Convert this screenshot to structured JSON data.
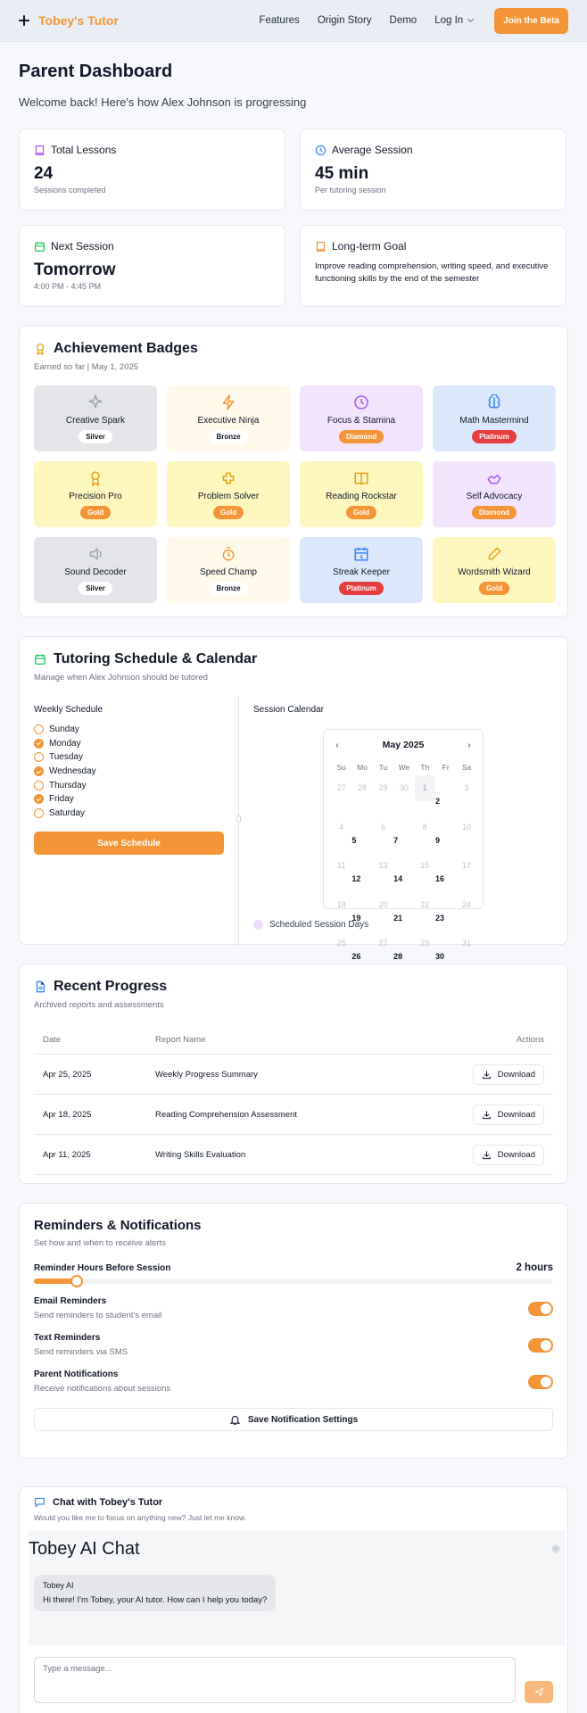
{
  "header": {
    "brand": "Tobey's Tutor",
    "nav": [
      "Features",
      "Origin Story",
      "Demo"
    ],
    "login": "Log In",
    "cta": "Join the Beta"
  },
  "page": {
    "title": "Parent Dashboard",
    "welcome": "Welcome back! Here's how Alex Johnson is progressing"
  },
  "stats": {
    "lessons": {
      "label": "Total Lessons",
      "value": "24",
      "sub": "Sessions completed"
    },
    "average": {
      "label": "Average Session",
      "value": "45 min",
      "sub": "Per tutoring session"
    },
    "next": {
      "label": "Next Session",
      "value": "Tomorrow",
      "sub": "4:00 PM - 4:45 PM"
    },
    "goal": {
      "label": "Long-term Goal",
      "text": "Improve reading comprehension, writing speed, and executive functioning skills by the end of the semester"
    }
  },
  "badges": {
    "title": "Achievement Badges",
    "subtitle": "Earned so far | May 1, 2025",
    "items": [
      {
        "name": "Creative Spark",
        "tier": "Silver"
      },
      {
        "name": "Executive Ninja",
        "tier": "Bronze"
      },
      {
        "name": "Focus & Stamina",
        "tier": "Diamond"
      },
      {
        "name": "Math Mastermind",
        "tier": "Platinum"
      },
      {
        "name": "Precision Pro",
        "tier": "Gold"
      },
      {
        "name": "Problem Solver",
        "tier": "Gold"
      },
      {
        "name": "Reading Rockstar",
        "tier": "Gold"
      },
      {
        "name": "Self Advocacy",
        "tier": "Diamond"
      },
      {
        "name": "Sound Decoder",
        "tier": "Silver"
      },
      {
        "name": "Speed Champ",
        "tier": "Bronze"
      },
      {
        "name": "Streak Keeper",
        "tier": "Platinum"
      },
      {
        "name": "Wordsmith Wizard",
        "tier": "Gold"
      }
    ],
    "tier_colors": {
      "Silver": {
        "bg": "#e4e5e8",
        "pill_bg": "#ffffff",
        "pill_fg": "#111827",
        "icon": "#9ca3af"
      },
      "Bronze": {
        "bg": "#fef9e8",
        "pill_bg": "#ffffff",
        "pill_fg": "#111827",
        "icon": "#f39536"
      },
      "Diamond": {
        "bg": "#f1e4fc",
        "pill_bg": "#f39536",
        "pill_fg": "#ffffff",
        "icon": "#a855f7"
      },
      "Platinum": {
        "bg": "#dbe8fb",
        "pill_bg": "#e53e3e",
        "pill_fg": "#ffffff",
        "icon": "#3b82f6"
      },
      "Gold": {
        "bg": "#fdf6bd",
        "pill_bg": "#f39536",
        "pill_fg": "#ffffff",
        "icon": "#e8a317"
      }
    }
  },
  "schedule": {
    "title": "Tutoring Schedule & Calendar",
    "subtitle": "Manage when Alex Johnson should be tutored",
    "weekly_label": "Weekly Schedule",
    "days": [
      {
        "name": "Sunday",
        "on": false
      },
      {
        "name": "Monday",
        "on": true
      },
      {
        "name": "Tuesday",
        "on": false
      },
      {
        "name": "Wednesday",
        "on": true
      },
      {
        "name": "Thursday",
        "on": false
      },
      {
        "name": "Friday",
        "on": true
      },
      {
        "name": "Saturday",
        "on": false
      }
    ],
    "save": "Save Schedule",
    "calendar_label": "Session Calendar",
    "month": "May 2025",
    "weekdays": [
      "Su",
      "Mo",
      "Tu",
      "We",
      "Th",
      "Fr",
      "Sa"
    ],
    "cells": [
      {
        "d": "27",
        "k": "muted"
      },
      {
        "d": "28",
        "k": "muted"
      },
      {
        "d": "29",
        "k": "muted"
      },
      {
        "d": "30",
        "k": "muted"
      },
      {
        "d": "1",
        "k": "today"
      },
      {
        "d": "2",
        "k": "sched"
      },
      {
        "d": "3",
        "k": "muted"
      },
      {
        "d": "4",
        "k": "muted"
      },
      {
        "d": "5",
        "k": "sched"
      },
      {
        "d": "6",
        "k": "muted"
      },
      {
        "d": "7",
        "k": "sched"
      },
      {
        "d": "8",
        "k": "muted"
      },
      {
        "d": "9",
        "k": "sched"
      },
      {
        "d": "10",
        "k": "muted"
      },
      {
        "d": "11",
        "k": "muted"
      },
      {
        "d": "12",
        "k": "sched"
      },
      {
        "d": "13",
        "k": "muted"
      },
      {
        "d": "14",
        "k": "sched"
      },
      {
        "d": "15",
        "k": "muted"
      },
      {
        "d": "16",
        "k": "sched"
      },
      {
        "d": "17",
        "k": "muted"
      },
      {
        "d": "18",
        "k": "muted"
      },
      {
        "d": "19",
        "k": "sched"
      },
      {
        "d": "20",
        "k": "muted"
      },
      {
        "d": "21",
        "k": "sched"
      },
      {
        "d": "22",
        "k": "muted"
      },
      {
        "d": "23",
        "k": "sched"
      },
      {
        "d": "24",
        "k": "muted"
      },
      {
        "d": "25",
        "k": "muted"
      },
      {
        "d": "26",
        "k": "sched"
      },
      {
        "d": "27",
        "k": "muted"
      },
      {
        "d": "28",
        "k": "sched"
      },
      {
        "d": "29",
        "k": "muted"
      },
      {
        "d": "30",
        "k": "sched"
      },
      {
        "d": "31",
        "k": "muted"
      }
    ],
    "legend": "Scheduled Session Days"
  },
  "progress": {
    "title": "Recent Progress",
    "subtitle": "Archived reports and assessments",
    "columns": [
      "Date",
      "Report Name",
      "Actions"
    ],
    "rows": [
      {
        "date": "Apr 25, 2025",
        "name": "Weekly Progress Summary",
        "action": "Download"
      },
      {
        "date": "Apr 18, 2025",
        "name": "Reading Comprehension Assessment",
        "action": "Download"
      },
      {
        "date": "Apr 11, 2025",
        "name": "Writing Skills Evaluation",
        "action": "Download"
      }
    ]
  },
  "reminders": {
    "title": "Reminders & Notifications",
    "subtitle": "Set how and when to receive alerts",
    "slider_label": "Reminder Hours Before Session",
    "slider_value": "2 hours",
    "slider_fraction": 0.083,
    "toggles": [
      {
        "title": "Email Reminders",
        "sub": "Send reminders to student's email",
        "on": true
      },
      {
        "title": "Text Reminders",
        "sub": "Send reminders via SMS",
        "on": true
      },
      {
        "title": "Parent Notifications",
        "sub": "Receive notifications about sessions",
        "on": true
      }
    ],
    "save": "Save Notification Settings"
  },
  "chat": {
    "title": "Chat with Tobey's Tutor",
    "subtitle": "Would you like me to focus on anything new? Just let me know.",
    "window_title": "Tobey AI Chat",
    "sender": "Tobey AI",
    "message": "Hi there! I'm Tobey, your AI tutor. How can I help you today?",
    "placeholder": "Type a message..."
  },
  "colors": {
    "accent": "#f39536",
    "danger": "#e53e3e",
    "background": "#f6f8fb"
  }
}
